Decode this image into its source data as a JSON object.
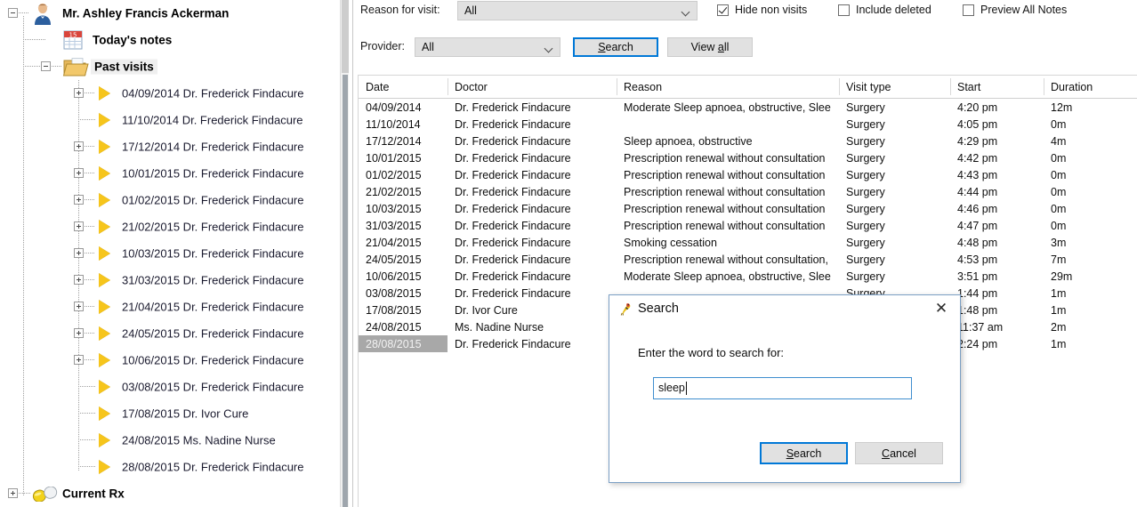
{
  "tree": {
    "patient": "Mr. Ashley Francis Ackerman",
    "todays_notes": "Today's notes",
    "past_visits": "Past visits",
    "current_rx": "Current Rx",
    "visits": [
      {
        "date": "04/09/2014",
        "provider": "Dr. Frederick Findacure",
        "expandable": true
      },
      {
        "date": "11/10/2014",
        "provider": "Dr. Frederick Findacure",
        "expandable": false
      },
      {
        "date": "17/12/2014",
        "provider": "Dr. Frederick Findacure",
        "expandable": true
      },
      {
        "date": "10/01/2015",
        "provider": "Dr. Frederick Findacure",
        "expandable": true
      },
      {
        "date": "01/02/2015",
        "provider": "Dr. Frederick Findacure",
        "expandable": true
      },
      {
        "date": "21/02/2015",
        "provider": "Dr. Frederick Findacure",
        "expandable": true
      },
      {
        "date": "10/03/2015",
        "provider": "Dr. Frederick Findacure",
        "expandable": true
      },
      {
        "date": "31/03/2015",
        "provider": "Dr. Frederick Findacure",
        "expandable": true
      },
      {
        "date": "21/04/2015",
        "provider": "Dr. Frederick Findacure",
        "expandable": true
      },
      {
        "date": "24/05/2015",
        "provider": "Dr. Frederick Findacure",
        "expandable": true
      },
      {
        "date": "10/06/2015",
        "provider": "Dr. Frederick Findacure",
        "expandable": true
      },
      {
        "date": "03/08/2015",
        "provider": "Dr. Frederick Findacure",
        "expandable": false
      },
      {
        "date": "17/08/2015",
        "provider": "Dr. Ivor Cure",
        "expandable": false
      },
      {
        "date": "24/08/2015",
        "provider": "Ms. Nadine Nurse",
        "expandable": false
      },
      {
        "date": "28/08/2015",
        "provider": "Dr. Frederick Findacure",
        "expandable": false
      }
    ]
  },
  "toolbar": {
    "reason_label": "Reason for visit:",
    "reason_value": "All",
    "provider_label": "Provider:",
    "provider_value": "All",
    "search_button": "Search",
    "search_button_accel": "S",
    "view_all_button": "View all",
    "view_all_accel": "a",
    "checkboxes": [
      {
        "label": "Hide non visits",
        "checked": true
      },
      {
        "label": "Include deleted",
        "checked": false
      },
      {
        "label": "Preview All Notes",
        "checked": false
      }
    ]
  },
  "grid": {
    "columns": [
      "Date",
      "Doctor",
      "Reason",
      "Visit type",
      "Start",
      "Duration"
    ],
    "rows": [
      {
        "date": "04/09/2014",
        "doctor": "Dr. Frederick Findacure",
        "reason": "Moderate Sleep apnoea, obstructive, Slee",
        "visit_type": "Surgery",
        "start": "4:20 pm",
        "duration": "12m",
        "selected": false
      },
      {
        "date": "11/10/2014",
        "doctor": "Dr. Frederick Findacure",
        "reason": "",
        "visit_type": "Surgery",
        "start": "4:05 pm",
        "duration": "0m",
        "selected": false
      },
      {
        "date": "17/12/2014",
        "doctor": "Dr. Frederick Findacure",
        "reason": "Sleep apnoea, obstructive",
        "visit_type": "Surgery",
        "start": "4:29 pm",
        "duration": "4m",
        "selected": false
      },
      {
        "date": "10/01/2015",
        "doctor": "Dr. Frederick Findacure",
        "reason": "Prescription renewal without consultation",
        "visit_type": "Surgery",
        "start": "4:42 pm",
        "duration": "0m",
        "selected": false
      },
      {
        "date": "01/02/2015",
        "doctor": "Dr. Frederick Findacure",
        "reason": "Prescription renewal without consultation",
        "visit_type": "Surgery",
        "start": "4:43 pm",
        "duration": "0m",
        "selected": false
      },
      {
        "date": "21/02/2015",
        "doctor": "Dr. Frederick Findacure",
        "reason": "Prescription renewal without consultation",
        "visit_type": "Surgery",
        "start": "4:44 pm",
        "duration": "0m",
        "selected": false
      },
      {
        "date": "10/03/2015",
        "doctor": "Dr. Frederick Findacure",
        "reason": "Prescription renewal without consultation",
        "visit_type": "Surgery",
        "start": "4:46 pm",
        "duration": "0m",
        "selected": false
      },
      {
        "date": "31/03/2015",
        "doctor": "Dr. Frederick Findacure",
        "reason": "Prescription renewal without consultation",
        "visit_type": "Surgery",
        "start": "4:47 pm",
        "duration": "0m",
        "selected": false
      },
      {
        "date": "21/04/2015",
        "doctor": "Dr. Frederick Findacure",
        "reason": "Smoking cessation",
        "visit_type": "Surgery",
        "start": "4:48 pm",
        "duration": "3m",
        "selected": false
      },
      {
        "date": "24/05/2015",
        "doctor": "Dr. Frederick Findacure",
        "reason": "Prescription renewal without consultation,",
        "visit_type": "Surgery",
        "start": "4:53 pm",
        "duration": "7m",
        "selected": false
      },
      {
        "date": "10/06/2015",
        "doctor": "Dr. Frederick Findacure",
        "reason": "Moderate Sleep apnoea, obstructive, Slee",
        "visit_type": "Surgery",
        "start": "3:51 pm",
        "duration": "29m",
        "selected": false
      },
      {
        "date": "03/08/2015",
        "doctor": "Dr. Frederick Findacure",
        "reason": "",
        "visit_type": "Surgery",
        "start": "1:44 pm",
        "duration": "1m",
        "selected": false
      },
      {
        "date": "17/08/2015",
        "doctor": "Dr. Ivor Cure",
        "reason": "",
        "visit_type": "",
        "start": "1:48 pm",
        "duration": "1m",
        "selected": false
      },
      {
        "date": "24/08/2015",
        "doctor": "Ms. Nadine Nurse",
        "reason": "",
        "visit_type": "",
        "start": "11:37 am",
        "duration": "2m",
        "selected": false
      },
      {
        "date": "28/08/2015",
        "doctor": "Dr. Frederick Findacure",
        "reason": "",
        "visit_type": "",
        "start": "2:24 pm",
        "duration": "1m",
        "selected": true
      }
    ]
  },
  "dialog": {
    "title": "Search",
    "prompt": "Enter the word to search for:",
    "input_value": "sleep",
    "input_placeholder": "",
    "search_button": "Search",
    "search_accel": "S",
    "cancel_button": "Cancel",
    "cancel_accel": "C",
    "close_glyph": "✕"
  },
  "colors": {
    "accent": "#0078d7",
    "selection": "#a8a8a8",
    "icon_yellow": "#f6c51c",
    "control_face": "#e1e1e1"
  }
}
